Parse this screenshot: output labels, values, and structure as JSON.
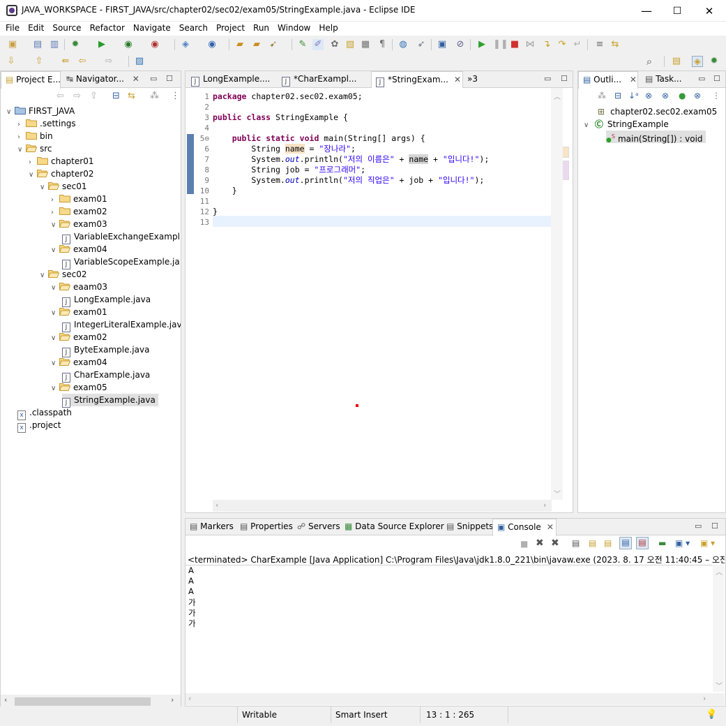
{
  "window": {
    "title": "JAVA_WORKSPACE - FIRST_JAVA/src/chapter02/sec02/exam05/StringExample.java - Eclipse IDE",
    "minimize": "—",
    "maximize": "☐",
    "close": "✕"
  },
  "menu": [
    "File",
    "Edit",
    "Source",
    "Refactor",
    "Navigate",
    "Search",
    "Project",
    "Run",
    "Window",
    "Help"
  ],
  "left_panel": {
    "tabs": [
      {
        "label": "Project E...",
        "icon": "package-explorer-icon"
      },
      {
        "label": "Navigator...",
        "icon": "navigator-icon"
      }
    ],
    "tree": [
      {
        "label": "FIRST_JAVA",
        "depth": 0,
        "type": "project",
        "expanded": true
      },
      {
        "label": ".settings",
        "depth": 1,
        "type": "folder",
        "expanded": false
      },
      {
        "label": "bin",
        "depth": 1,
        "type": "folder",
        "expanded": false
      },
      {
        "label": "src",
        "depth": 1,
        "type": "folder",
        "expanded": true
      },
      {
        "label": "chapter01",
        "depth": 2,
        "type": "folder",
        "expanded": false
      },
      {
        "label": "chapter02",
        "depth": 2,
        "type": "folder",
        "expanded": true
      },
      {
        "label": "sec01",
        "depth": 3,
        "type": "folder",
        "expanded": true
      },
      {
        "label": "exam01",
        "depth": 4,
        "type": "folder",
        "expanded": false
      },
      {
        "label": "exam02",
        "depth": 4,
        "type": "folder",
        "expanded": false
      },
      {
        "label": "exam03",
        "depth": 4,
        "type": "folder",
        "expanded": true
      },
      {
        "label": "VariableExchangeExampl",
        "depth": 5,
        "type": "java"
      },
      {
        "label": "exam04",
        "depth": 4,
        "type": "folder",
        "expanded": true
      },
      {
        "label": "VariableScopeExample.ja",
        "depth": 5,
        "type": "java"
      },
      {
        "label": "sec02",
        "depth": 3,
        "type": "folder",
        "expanded": true
      },
      {
        "label": "eaam03",
        "depth": 4,
        "type": "folder",
        "expanded": true
      },
      {
        "label": "LongExample.java",
        "depth": 5,
        "type": "java"
      },
      {
        "label": "exam01",
        "depth": 4,
        "type": "folder",
        "expanded": true
      },
      {
        "label": "IntegerLiteralExample.java",
        "depth": 5,
        "type": "java"
      },
      {
        "label": "exam02",
        "depth": 4,
        "type": "folder",
        "expanded": true
      },
      {
        "label": "ByteExample.java",
        "depth": 5,
        "type": "java"
      },
      {
        "label": "exam04",
        "depth": 4,
        "type": "folder",
        "expanded": true
      },
      {
        "label": "CharExample.java",
        "depth": 5,
        "type": "java"
      },
      {
        "label": "exam05",
        "depth": 4,
        "type": "folder",
        "expanded": true
      },
      {
        "label": "StringExample.java",
        "depth": 5,
        "type": "java",
        "selected": true
      },
      {
        "label": ".classpath",
        "depth": 1,
        "type": "xml"
      },
      {
        "label": ".project",
        "depth": 1,
        "type": "xml"
      }
    ]
  },
  "editor": {
    "tabs": [
      {
        "label": "LongExample....",
        "active": false
      },
      {
        "label": "*CharExampl...",
        "active": false
      },
      {
        "label": "*StringExam...",
        "active": true
      }
    ],
    "overflow": "»3",
    "lines": [
      "1",
      "2",
      "3",
      "4",
      "5⊖",
      "6",
      "7",
      "8",
      "9",
      "10",
      "11",
      "12",
      "13"
    ],
    "code": {
      "l1_kw": "package",
      "l1_rest": " chapter02.sec02.exam05;",
      "l3_kw1": "public",
      "l3_kw2": "class",
      "l3_rest": " StringExample {",
      "l5_kw1": "public",
      "l5_kw2": "static",
      "l5_kw3": "void",
      "l5_rest": " main(String[] args) {",
      "l6_a": "String ",
      "l6_name": "name",
      "l6_b": " = ",
      "l6_str": "\"장나라\"",
      "l6_c": ";",
      "l7_a": "System.",
      "l7_out": "out",
      "l7_b": ".println(",
      "l7_str": "\"저의 이름은\"",
      "l7_c": " + ",
      "l7_name": "name",
      "l7_d": " + ",
      "l7_str2": "\"입니다!\"",
      "l7_e": ");",
      "l8_a": "String job = ",
      "l8_str": "\"프로그래머\"",
      "l8_c": ";",
      "l9_a": "System.",
      "l9_out": "out",
      "l9_b": ".println(",
      "l9_str": "\"저의 직업은\"",
      "l9_c": " + job + ",
      "l9_str2": "\"입니다!\"",
      "l9_e": ");",
      "l10": "}",
      "l12": "}"
    }
  },
  "outline": {
    "tabs": [
      {
        "label": "Outli...",
        "active": true
      },
      {
        "label": "Task...",
        "active": false
      }
    ],
    "items": [
      {
        "label": "chapter02.sec02.exam05",
        "type": "package"
      },
      {
        "label": "StringExample",
        "type": "class"
      },
      {
        "label": "main(String[]) : void",
        "type": "method",
        "selected": true
      }
    ]
  },
  "bottom": {
    "tabs": [
      {
        "label": "Markers"
      },
      {
        "label": "Properties"
      },
      {
        "label": "Servers"
      },
      {
        "label": "Data Source Explorer"
      },
      {
        "label": "Snippets"
      },
      {
        "label": "Console",
        "active": true
      }
    ],
    "console_header": "<terminated> CharExample [Java Application] C:\\Program Files\\Java\\jdk1.8.0_221\\bin\\javaw.exe  (2023. 8. 17 오전 11:40:45 – 오전 11:40:",
    "console_lines": [
      "A",
      "A",
      "A",
      "가",
      "가",
      "가"
    ]
  },
  "status": {
    "writable": "Writable",
    "insert_mode": "Smart Insert",
    "position": "13 : 1 : 265"
  }
}
